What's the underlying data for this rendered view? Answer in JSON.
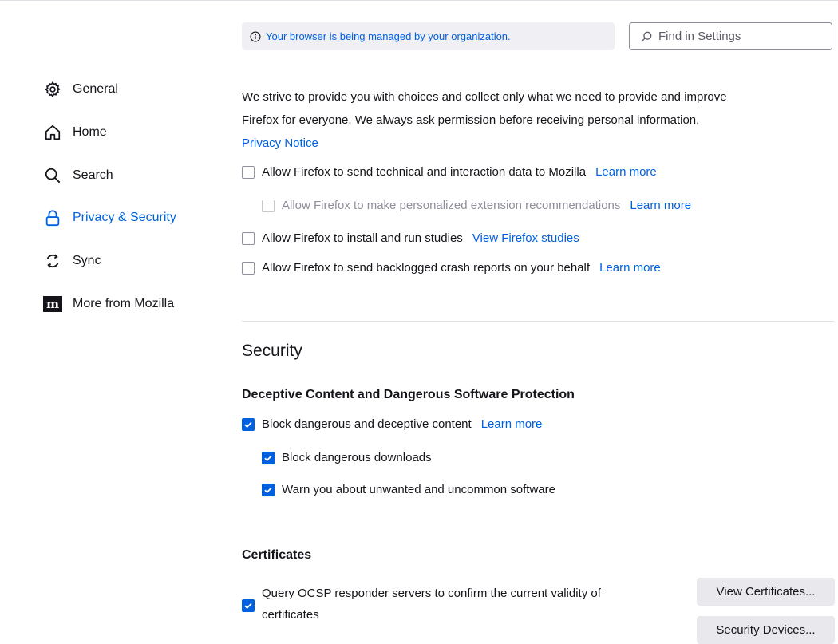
{
  "sidebar": {
    "items": [
      {
        "label": "General",
        "icon": "gear-icon",
        "active": false
      },
      {
        "label": "Home",
        "icon": "home-icon",
        "active": false
      },
      {
        "label": "Search",
        "icon": "search-icon",
        "active": false
      },
      {
        "label": "Privacy & Security",
        "icon": "lock-icon",
        "active": true
      },
      {
        "label": "Sync",
        "icon": "sync-icon",
        "active": false
      },
      {
        "label": "More from Mozilla",
        "icon": "mozilla-m-icon",
        "active": false
      }
    ]
  },
  "managed_banner": {
    "text": "Your browser is being managed by your organization."
  },
  "search": {
    "placeholder": "Find in Settings"
  },
  "data_collection": {
    "intro_line1": "We strive to provide you with choices and collect only what we need to provide and improve",
    "intro_line2": "Firefox for everyone. We always ask permission before receiving personal information.",
    "privacy_notice": "Privacy Notice",
    "options": [
      {
        "label": "Allow Firefox to send technical and interaction data to Mozilla",
        "link": "Learn more",
        "checked": false,
        "disabled": false
      },
      {
        "label": "Allow Firefox to make personalized extension recommendations",
        "link": "Learn more",
        "checked": false,
        "disabled": true
      },
      {
        "label": "Allow Firefox to install and run studies",
        "link": "View Firefox studies",
        "checked": false,
        "disabled": false
      },
      {
        "label": "Allow Firefox to send backlogged crash reports on your behalf",
        "link": "Learn more",
        "checked": false,
        "disabled": false
      }
    ]
  },
  "security": {
    "heading": "Security",
    "deceptive_heading": "Deceptive Content and Dangerous Software Protection",
    "block_dangerous": {
      "label": "Block dangerous and deceptive content",
      "link": "Learn more",
      "checked": true
    },
    "block_downloads": {
      "label": "Block dangerous downloads",
      "checked": true
    },
    "warn_unwanted": {
      "label": "Warn you about unwanted and uncommon software",
      "checked": true
    },
    "certificates_heading": "Certificates",
    "ocsp": {
      "line1": "Query OCSP responder servers to confirm the current validity of",
      "line2": "certificates",
      "checked": true
    },
    "view_certificates": "View Certificates...",
    "security_devices": "Security Devices..."
  },
  "colors": {
    "accent": "#0061e0",
    "text": "#15141a",
    "muted": "#8f8f9d",
    "button_bg": "#e9e9ed"
  }
}
